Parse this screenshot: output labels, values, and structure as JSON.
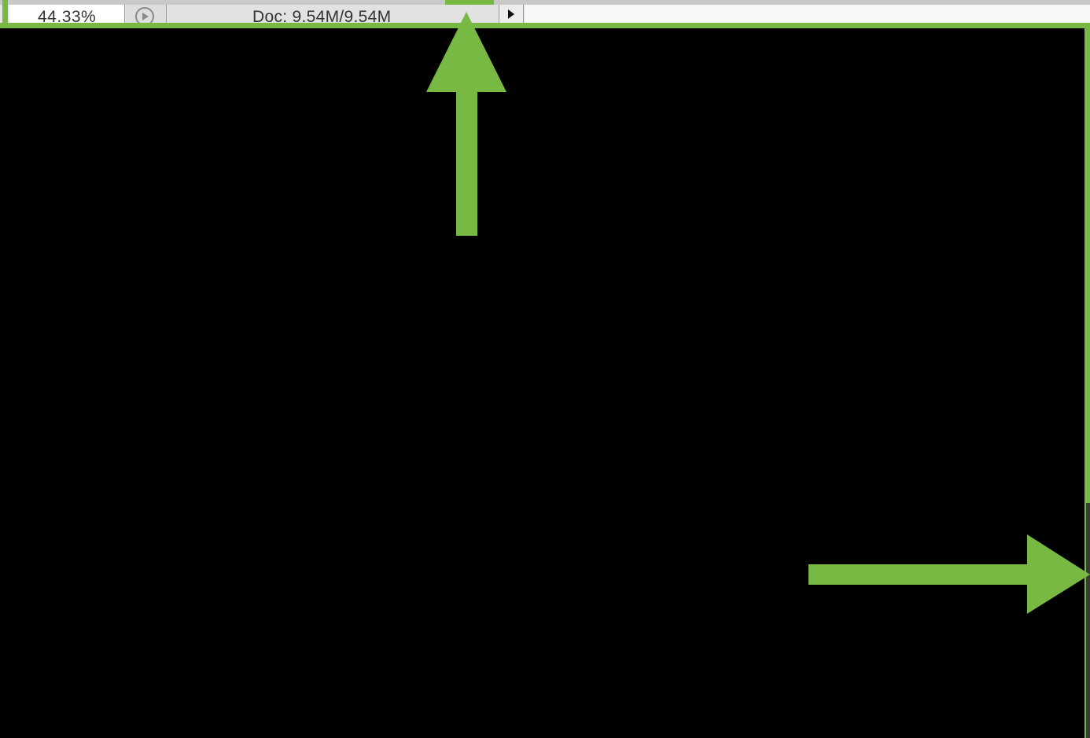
{
  "status_bar": {
    "zoom_level": "44.33%",
    "doc_info": "Doc: 9.54M/9.54M",
    "preview_icon": "preview-circle-icon",
    "menu_icon": "triangle-right-icon"
  },
  "annotation": {
    "color": "#77b943",
    "arrow_up": "arrow-up-annotation",
    "arrow_right": "arrow-right-annotation"
  },
  "canvas": {
    "background": "#000000"
  }
}
